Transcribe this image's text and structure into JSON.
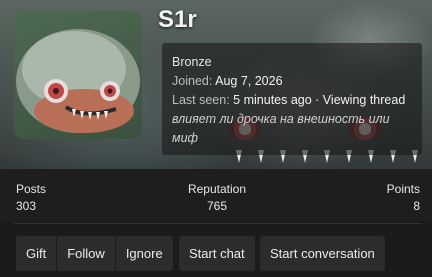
{
  "profile": {
    "username": "S1r",
    "rank": "Bronze",
    "joined_label": "Joined:",
    "joined_value": "Aug 7, 2026",
    "last_seen_label": "Last seen:",
    "last_seen_value": "5 minutes ago · Viewing thread",
    "status_message": "влияет ли дрочка на внешность или миф"
  },
  "stats": {
    "posts_label": "Posts",
    "posts_value": "303",
    "reputation_label": "Reputation",
    "reputation_value": "765",
    "points_label": "Points",
    "points_value": "8"
  },
  "actions": {
    "gift": "Gift",
    "follow": "Follow",
    "ignore": "Ignore",
    "start_chat": "Start chat",
    "start_conversation": "Start conversation"
  },
  "colors": {
    "page_background": "#1b1b1b",
    "button_background": "#2c2c2c",
    "text": "#e6e6e6",
    "avatar_eye": "#c0464a"
  }
}
